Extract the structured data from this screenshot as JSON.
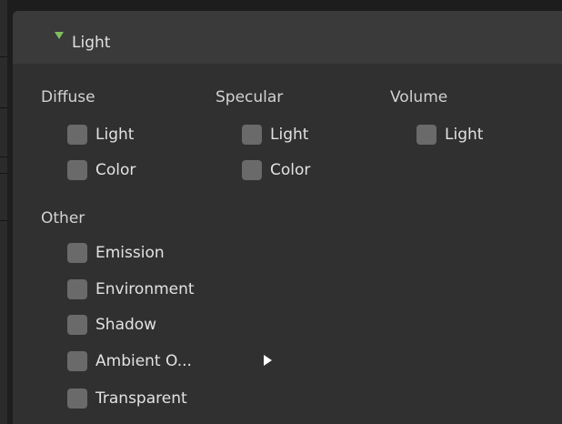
{
  "panel": {
    "title": "Light",
    "expanded": true,
    "arrow_color": "#7fbf5f"
  },
  "columns": [
    {
      "heading": "Diffuse",
      "items": [
        {
          "label": "Light",
          "checked": false
        },
        {
          "label": "Color",
          "checked": false
        }
      ]
    },
    {
      "heading": "Specular",
      "items": [
        {
          "label": "Light",
          "checked": false
        },
        {
          "label": "Color",
          "checked": false
        }
      ]
    },
    {
      "heading": "Volume",
      "items": [
        {
          "label": "Light",
          "checked": false
        }
      ]
    }
  ],
  "other": {
    "heading": "Other",
    "items": [
      {
        "label": "Emission",
        "checked": false
      },
      {
        "label": "Environment",
        "checked": false
      },
      {
        "label": "Shadow",
        "checked": false
      },
      {
        "label": "Ambient O...",
        "checked": false,
        "has_submenu": true
      },
      {
        "label": "Transparent",
        "checked": false
      }
    ]
  },
  "colors": {
    "background": "#1d1d1d",
    "panel": "#303030",
    "header": "#3a3a3a",
    "checkbox": "#6a6a6a",
    "text": "#e2e2e2"
  },
  "icons": {
    "header_toggle": "triangle-down-icon",
    "submenu": "triangle-right-icon"
  }
}
